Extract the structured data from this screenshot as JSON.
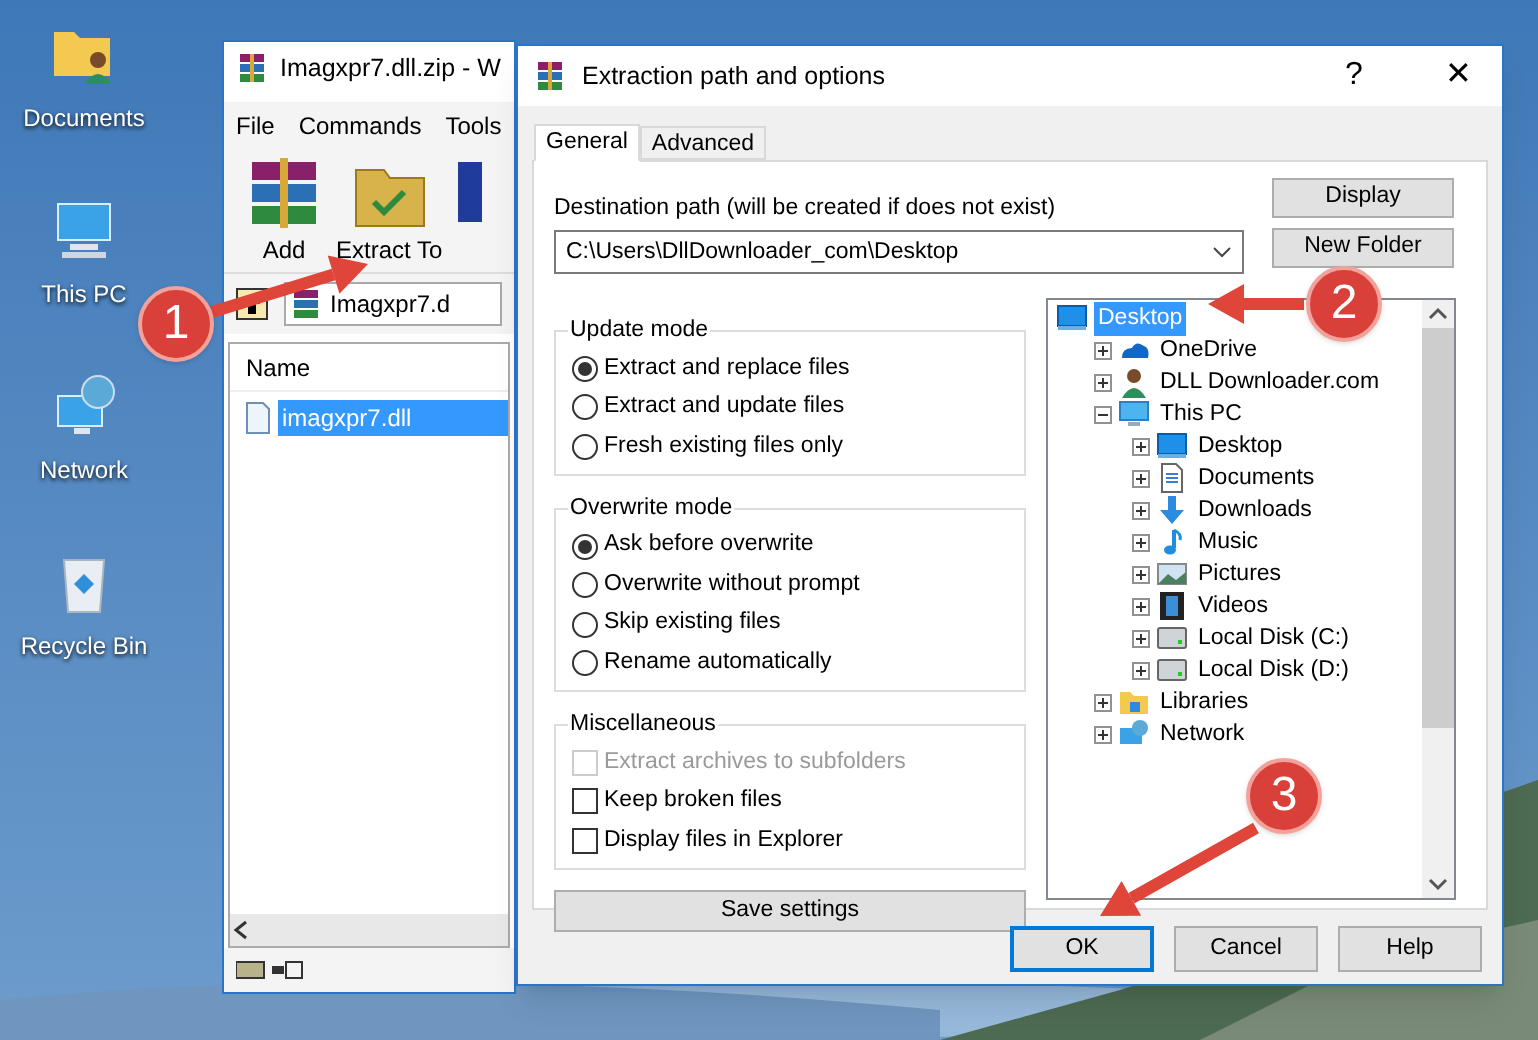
{
  "desktop_icons": [
    {
      "label": "Documents",
      "kind": "user-folder"
    },
    {
      "label": "This PC",
      "kind": "computer"
    },
    {
      "label": "Network",
      "kind": "network"
    },
    {
      "label": "Recycle Bin",
      "kind": "bin"
    }
  ],
  "archive_window": {
    "title": "Imagxpr7.dll.zip - W",
    "menu": [
      "File",
      "Commands",
      "Tools"
    ],
    "toolbar": [
      {
        "label": "Add",
        "kind": "add"
      },
      {
        "label": "Extract To",
        "kind": "extract"
      },
      {
        "kind": "book"
      }
    ],
    "address": "Imagxpr7.d",
    "column": "Name",
    "files": [
      {
        "name": "imagxpr7.dll",
        "selected": true
      }
    ]
  },
  "dialog": {
    "title": "Extraction path and options",
    "title_buttons": [
      "?",
      "✕"
    ],
    "tabs": [
      {
        "label": "General",
        "selected": true
      },
      {
        "label": "Advanced",
        "selected": false
      }
    ],
    "destination_label": "Destination path (will be created if does not exist)",
    "destination_path": "C:\\Users\\DllDownloader_com\\Desktop",
    "side_buttons": [
      "Display",
      "New Folder"
    ],
    "groups": [
      {
        "title": "Update mode",
        "options": [
          {
            "kind": "radio",
            "label": "Extract and replace files",
            "checked": true
          },
          {
            "kind": "radio",
            "label": "Extract and update files",
            "checked": false
          },
          {
            "kind": "radio",
            "label": "Fresh existing files only",
            "checked": false
          }
        ]
      },
      {
        "title": "Overwrite mode",
        "options": [
          {
            "kind": "radio",
            "label": "Ask before overwrite",
            "checked": true
          },
          {
            "kind": "radio",
            "label": "Overwrite without prompt",
            "checked": false
          },
          {
            "kind": "radio",
            "label": "Skip existing files",
            "checked": false
          },
          {
            "kind": "radio",
            "label": "Rename automatically",
            "checked": false
          }
        ]
      },
      {
        "title": "Miscellaneous",
        "options": [
          {
            "kind": "checkbox",
            "label": "Extract archives to subfolders",
            "checked": false,
            "disabled": true
          },
          {
            "kind": "checkbox",
            "label": "Keep broken files",
            "checked": false,
            "disabled": false
          },
          {
            "kind": "checkbox",
            "label": "Display files in Explorer",
            "checked": false,
            "disabled": false
          }
        ]
      }
    ],
    "save_button": "Save settings",
    "tree": [
      {
        "label": "Desktop",
        "kind": "desktop",
        "selected": true,
        "children": [
          {
            "label": "OneDrive",
            "kind": "cloud",
            "selected": false,
            "expanded": false
          },
          {
            "label": "DLL Downloader.com",
            "kind": "user",
            "selected": false,
            "expanded": false
          },
          {
            "label": "This PC",
            "kind": "computer",
            "selected": false,
            "expanded": true,
            "children": [
              {
                "label": "Desktop",
                "kind": "desktop",
                "selected": false,
                "expanded": false
              },
              {
                "label": "Documents",
                "kind": "document",
                "selected": false,
                "expanded": false
              },
              {
                "label": "Downloads",
                "kind": "download",
                "selected": false,
                "expanded": false
              },
              {
                "label": "Music",
                "kind": "music",
                "selected": false,
                "expanded": false
              },
              {
                "label": "Pictures",
                "kind": "picture",
                "selected": false,
                "expanded": false
              },
              {
                "label": "Videos",
                "kind": "video",
                "selected": false,
                "expanded": false
              },
              {
                "label": "Local Disk (C:)",
                "kind": "disk",
                "selected": false,
                "expanded": false
              },
              {
                "label": "Local Disk (D:)",
                "kind": "disk",
                "selected": false,
                "expanded": false
              }
            ]
          },
          {
            "label": "Libraries",
            "kind": "folder",
            "selected": false,
            "expanded": false
          },
          {
            "label": "Network",
            "kind": "network",
            "selected": false,
            "expanded": false
          }
        ]
      }
    ],
    "buttons": [
      {
        "label": "OK",
        "default": true
      },
      {
        "label": "Cancel",
        "default": false
      },
      {
        "label": "Help",
        "default": false
      }
    ]
  },
  "annotations": [
    {
      "label": "1"
    },
    {
      "label": "2"
    },
    {
      "label": "3"
    }
  ]
}
